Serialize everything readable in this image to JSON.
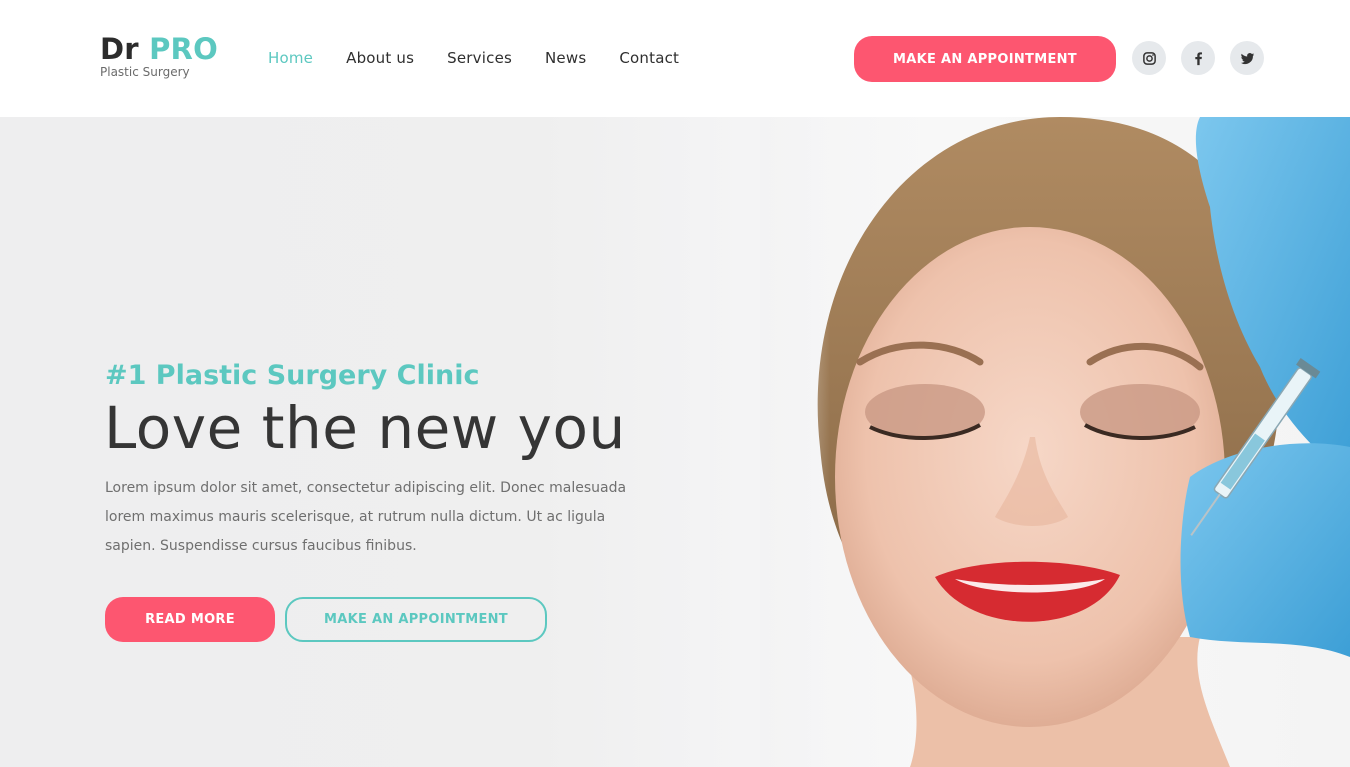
{
  "brand": {
    "name_main": "Dr",
    "name_accent": "PRO",
    "tagline": "Plastic Surgery"
  },
  "nav": {
    "items": [
      {
        "label": "Home",
        "active": true
      },
      {
        "label": "About us"
      },
      {
        "label": "Services"
      },
      {
        "label": "News"
      },
      {
        "label": "Contact"
      }
    ]
  },
  "header": {
    "cta_label": "MAKE AN APPOINTMENT",
    "social": [
      {
        "name": "instagram-icon"
      },
      {
        "name": "facebook-icon"
      },
      {
        "name": "twitter-icon"
      }
    ]
  },
  "hero": {
    "kicker": "#1 Plastic Surgery Clinic",
    "headline": "Love the new you",
    "lead": "Lorem ipsum dolor sit amet, consectetur adipiscing elit. Donec malesuada lorem maximus mauris scelerisque, at rutrum nulla dictum. Ut ac ligula sapien. Suspendisse cursus faucibus finibus.",
    "primary_label": "READ MORE",
    "secondary_label": "MAKE AN APPOINTMENT"
  },
  "colors": {
    "accent": "#5cc8c0",
    "brand_red": "#fd5670",
    "text_dark": "#353535"
  }
}
